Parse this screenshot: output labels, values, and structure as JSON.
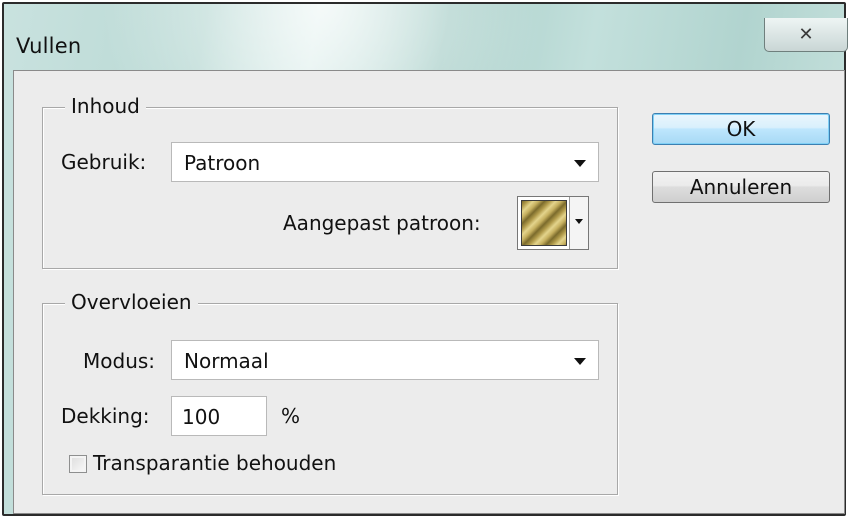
{
  "window": {
    "title": "Vullen",
    "close_icon": "close-icon"
  },
  "contents": {
    "legend": "Inhoud",
    "use_label": "Gebruik:",
    "use_value": "Patroon",
    "pattern_label": "Aangepast patroon:"
  },
  "blending": {
    "legend": "Overvloeien",
    "mode_label": "Modus:",
    "mode_value": "Normaal",
    "opacity_label": "Dekking:",
    "opacity_value": "100",
    "opacity_unit": "%",
    "preserve_label": "Transparantie behouden",
    "preserve_checked": false
  },
  "buttons": {
    "ok": "OK",
    "cancel": "Annuleren"
  }
}
